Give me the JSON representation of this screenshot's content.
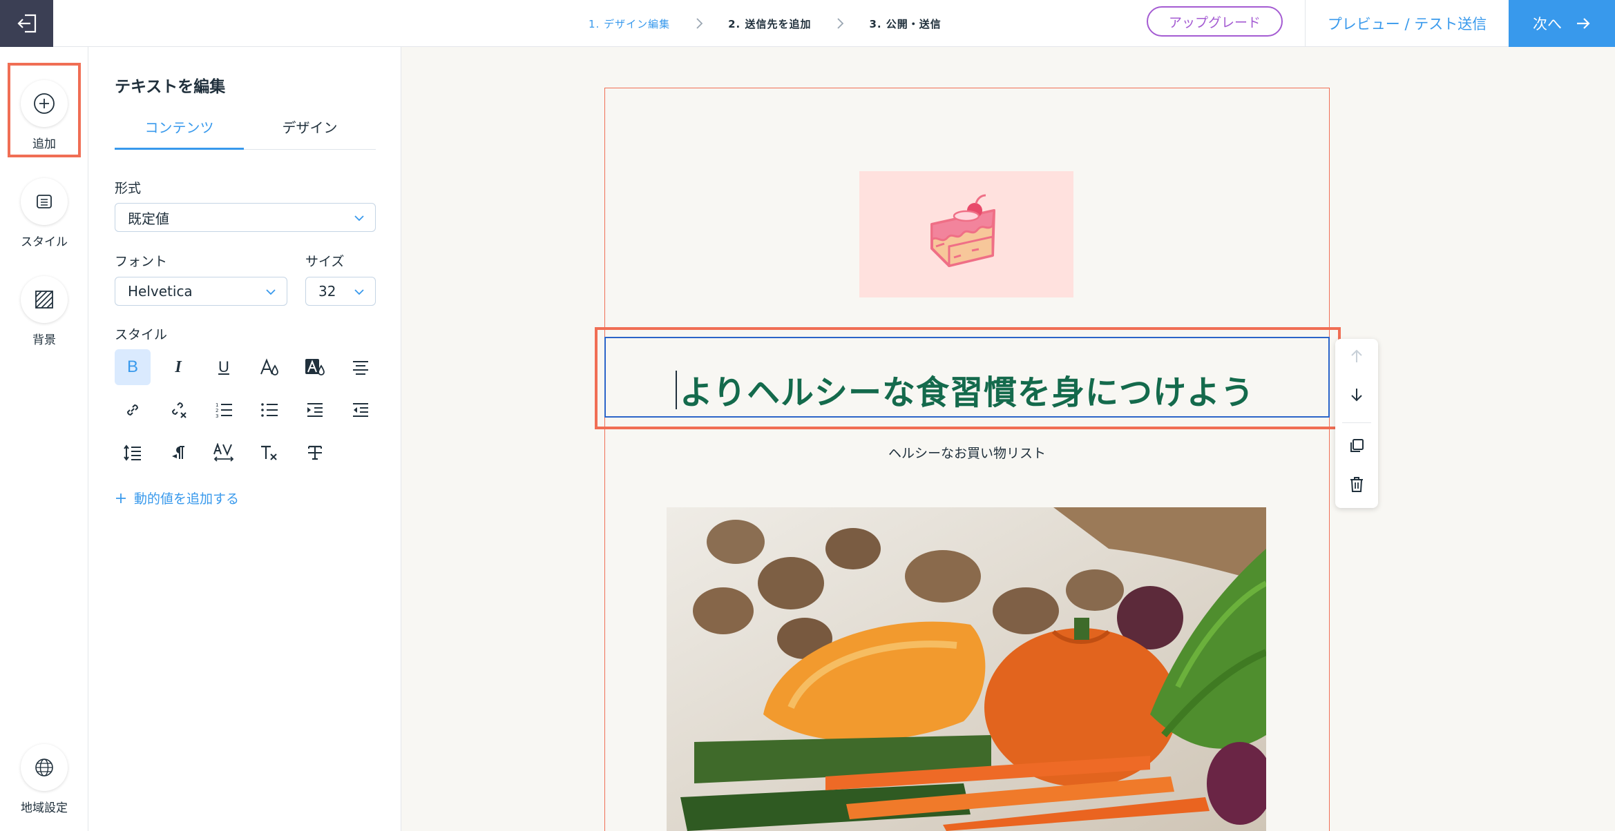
{
  "topbar": {
    "steps": [
      {
        "label": "1. デザイン編集",
        "active": true
      },
      {
        "label": "2. 送信先を追加",
        "active": false
      },
      {
        "label": "3. 公開・送信",
        "active": false
      }
    ],
    "upgrade_label": "アップグレード",
    "preview_label": "プレビュー / テスト送信",
    "next_label": "次へ"
  },
  "rail": {
    "add_label": "追加",
    "style_label": "スタイル",
    "background_label": "背景",
    "locale_label": "地域設定"
  },
  "panel": {
    "title": "テキストを編集",
    "tabs": [
      "コンテンツ",
      "デザイン"
    ],
    "format_label": "形式",
    "format_value": "既定値",
    "font_label": "フォント",
    "font_value": "Helvetica",
    "size_label": "サイズ",
    "size_value": "32",
    "style_label": "スタイル",
    "bold_glyph": "B",
    "italic_glyph": "I",
    "underline_glyph": "U",
    "dynamic_value_label": "動的値を追加する"
  },
  "canvas": {
    "heading": "よりヘルシーな食習慣を身につけよう",
    "subheading": "ヘルシーなお買い物リスト"
  },
  "colors": {
    "accent": "#3899ec",
    "highlight": "#f06e54",
    "heading_text": "#146a4c",
    "upgrade": "#a45bd2",
    "logo_bg": "#ffe1de"
  }
}
